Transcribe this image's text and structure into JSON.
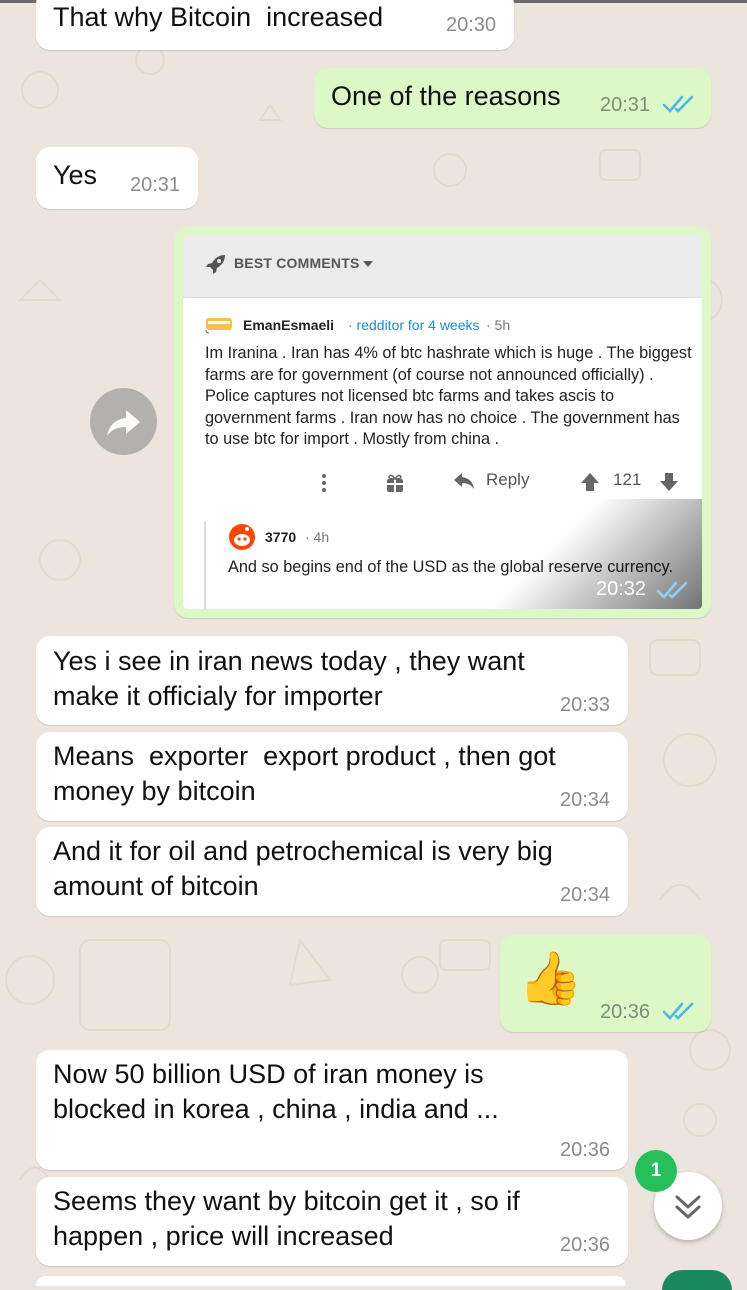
{
  "messages": [
    {
      "text": "That why Bitcoin  increased",
      "time": "20:30"
    },
    {
      "text": "One of the reasons",
      "time": "20:31"
    },
    {
      "text": "Yes",
      "time": "20:31"
    },
    {
      "text": "Yes i see in iran news today , they want\nmake it officialy for importer",
      "time": "20:33"
    },
    {
      "text": "Means  exporter  export product , then got\nmoney by bitcoin",
      "time": "20:34"
    },
    {
      "text": "And it for oil and petrochemical is very big\namount of bitcoin",
      "time": "20:34"
    },
    {
      "text": "👍",
      "time": "20:36"
    },
    {
      "text": "Now 50 billion USD of iran money is\nblocked in korea , china , india and ...",
      "time": "20:36"
    },
    {
      "text": "Seems they want by bitcoin get it , so if\nhappen , price will increased",
      "time": "20:36"
    }
  ],
  "image_message": {
    "time": "20:32",
    "header": "BEST COMMENTS",
    "comment": {
      "user": "EmanEsmaeli",
      "flair": "· redditor for 4 weeks",
      "age": "· 5h",
      "body": "Im Iranina . Iran has 4% of btc hashrate which is huge . The biggest farms are for government (of course not announced officially) . Police captures not licensed btc farms and takes ascis to government farms . Iran now has no choice . The government has to use btc for import . Mostly from china .",
      "reply_label": "Reply",
      "votes": "121"
    },
    "reply": {
      "user": "3770",
      "age": "· 4h",
      "body": "And so begins end of the USD as the global reserve currency."
    }
  },
  "scroll_fab": {
    "badge": "1"
  },
  "colors": {
    "background": "#ece5dd",
    "incoming": "#ffffff",
    "outgoing": "#dcf8c6",
    "read_ticks": "#4fb6ec",
    "badge": "#25c05a"
  },
  "icons": [
    "forward-icon",
    "double-check-icon",
    "chevron-double-down-icon",
    "rocket-icon",
    "caret-down-icon",
    "more-vertical-icon",
    "gift-icon",
    "reply-arrow-icon",
    "upvote-icon",
    "downvote-icon"
  ]
}
